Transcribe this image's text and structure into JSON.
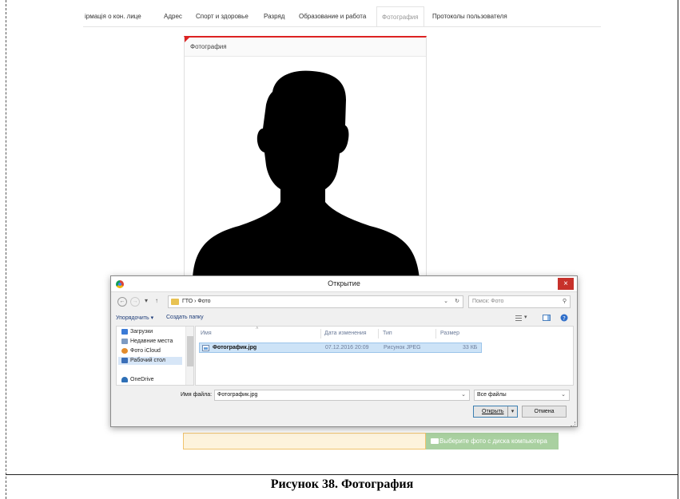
{
  "tabs": [
    "ірмація о кон. лице",
    "Адрес",
    "Спорт и здоровье",
    "Разряд",
    "Образование и работа",
    "Фотография",
    "Протоколы пользователя"
  ],
  "active_tab": "Фотография",
  "photo_panel": {
    "title": "Фотография"
  },
  "upload": {
    "input_value": "",
    "button_label": "Выберите фото с диска компьютера"
  },
  "dialog": {
    "title": "Открытие",
    "close_label": "×",
    "breadcrumb": "ГТО › Фото",
    "search_placeholder": "Поиск: Фото",
    "organize_label": "Упорядочить ▾",
    "new_folder_label": "Создать папку",
    "nav_items": [
      {
        "label": "Загрузки",
        "icon": "downloads-icon",
        "color": "#3a7ad6"
      },
      {
        "label": "Недавние места",
        "icon": "recent-places-icon",
        "color": "#7d9bc2"
      },
      {
        "label": "Фото iCloud",
        "icon": "icloud-photos-icon",
        "color": "#e38c2c"
      },
      {
        "label": "Рабочий стол",
        "icon": "desktop-icon",
        "color": "#3b6fb8"
      },
      {
        "label": "OneDrive",
        "icon": "onedrive-icon",
        "color": "#2e6fb6"
      }
    ],
    "selected_nav": "Рабочий стол",
    "columns": [
      "Имя",
      "Дата изменения",
      "Тип",
      "Размер"
    ],
    "files": [
      {
        "name": "Фотографик.jpg",
        "modified": "07.12.2016 20:09",
        "type": "Рисунок JPEG",
        "size": "33 КБ"
      }
    ],
    "filename_label": "Имя файла:",
    "filename_value": "Фотографик.jpg",
    "filetype_value": "Все файлы",
    "open_label": "Открыть",
    "cancel_label": "Отмена"
  },
  "caption": "Рисунок 38. Фотография",
  "colors": {
    "accent_red": "#dd2222",
    "upload_green": "#a9d0a0",
    "close_red": "#c7312b"
  }
}
